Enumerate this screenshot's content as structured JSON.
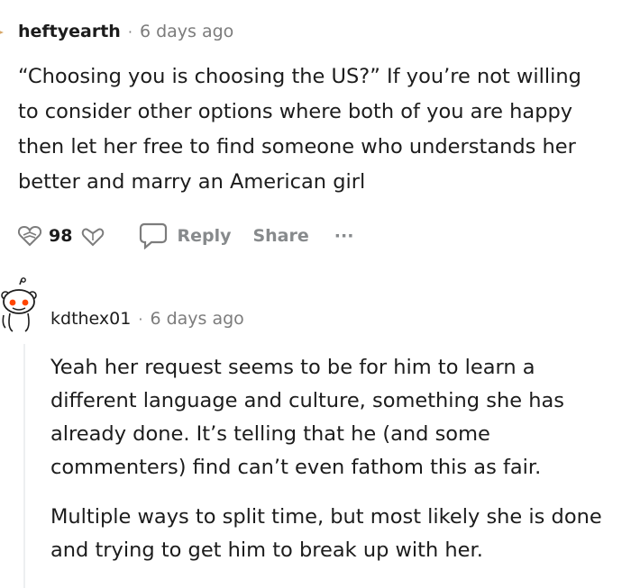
{
  "comment1": {
    "author": "heftyearth",
    "separator": "·",
    "timestamp": "6 days ago",
    "body": "“Choosing you is choosing the US?” If you’re not willing to consider other options where both of you are happy then let her free to find someone who understands her better and marry an American girl",
    "votes": "98",
    "actions": {
      "reply": "Reply",
      "share": "Share",
      "more": "···"
    }
  },
  "comment2": {
    "author": "kdthex01",
    "separator": "·",
    "timestamp": "6 days ago",
    "paragraphs": [
      "Yeah her request seems to be for him to learn a different language and culture, something she has already done. It’s telling that he (and some commenters) find can’t even fathom this as fair.",
      "Multiple ways to split time, but most likely she is done and trying to get him to break up with her."
    ]
  }
}
